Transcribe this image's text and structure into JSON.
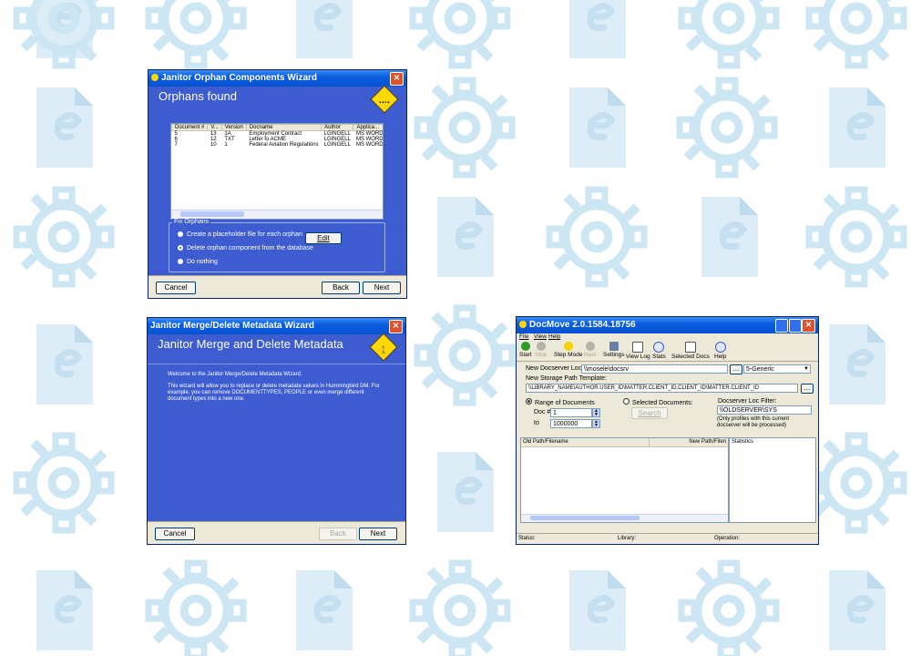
{
  "orphans_wizard": {
    "title": "Janitor Orphan Components Wizard",
    "header_title": "Orphans found",
    "columns": [
      "Document #",
      "V...",
      "Version",
      "Docname",
      "Author",
      "Applica..."
    ],
    "rows": [
      [
        "5",
        "13",
        "1A",
        "Employment Contract",
        "LGINGELL",
        "MS WORD"
      ],
      [
        "6",
        "12",
        "TXT",
        "Letter to ACME",
        "LGINGELL",
        "MS WORD"
      ],
      [
        "7",
        "10",
        "1",
        "Federal Aviation Regulations",
        "LGINGELL",
        "MS WORD"
      ]
    ],
    "group_label": "Fix Orphans",
    "options": [
      "Create a placeholder file for each orphan",
      "Delete orphan component from the database",
      "Do nothing"
    ],
    "edit_label": "Edit",
    "cancel_label": "Cancel",
    "back_label": "Back",
    "next_label": "Next"
  },
  "merge_wizard": {
    "title": "Janitor Merge/Delete Metadata Wizard",
    "header_title": "Janitor Merge and Delete Metadata",
    "welcome": "Welcome to the Janitor Merge/Delete Metadata Wizard.",
    "desc": "This wizard will allow you to replace or delete metadata values in Hummingbird DM. For example, you can remove DOCUMENTTYPES, PEOPLE or even merge different document types into a new one.",
    "cancel_label": "Cancel",
    "back_label": "Back",
    "next_label": "Next"
  },
  "docmove": {
    "title": "DocMove 2.0.1584.18756",
    "menu": [
      "File",
      "View",
      "Help"
    ],
    "toolbar": [
      "Start",
      "Stop",
      "Step Mode",
      "Next",
      "Settings",
      "View Log",
      "Stats",
      "Selected Docs",
      "Help"
    ],
    "docserver_label": "New Docserver Location:",
    "docserver_value": "\\\\mosele\\docsrv",
    "combo_value": "5-Generic",
    "template_label": "New Storage Path Template:",
    "template_value": "\\\\LIBRARY_NAME\\AUTHOR.USER_ID\\MATTER.CLIENT_ID.CLIENT_ID\\MATTER.CLIENT_ID",
    "range_label": "Range of Documents",
    "selected_label": "Selected Documents:",
    "filter_label": "Docserver Loc Filter:",
    "filter_value": "\\\\OLDSERVER\\SYS",
    "filter_note": "(Only profiles with this current docserver will be processed)",
    "doc_label": "Doc #",
    "doc_from": "1",
    "to_label": "to",
    "doc_to": "1000000",
    "search_label": "Search",
    "col_old": "Old Path/Filename",
    "col_new": "New Path/Filen",
    "statistics": "Statistics",
    "status": "Status:",
    "library": "Library:",
    "operation": "Operation:"
  },
  "colors": {
    "xp_blue": "#3c5ccf",
    "watermark": "#d9ecf6"
  }
}
